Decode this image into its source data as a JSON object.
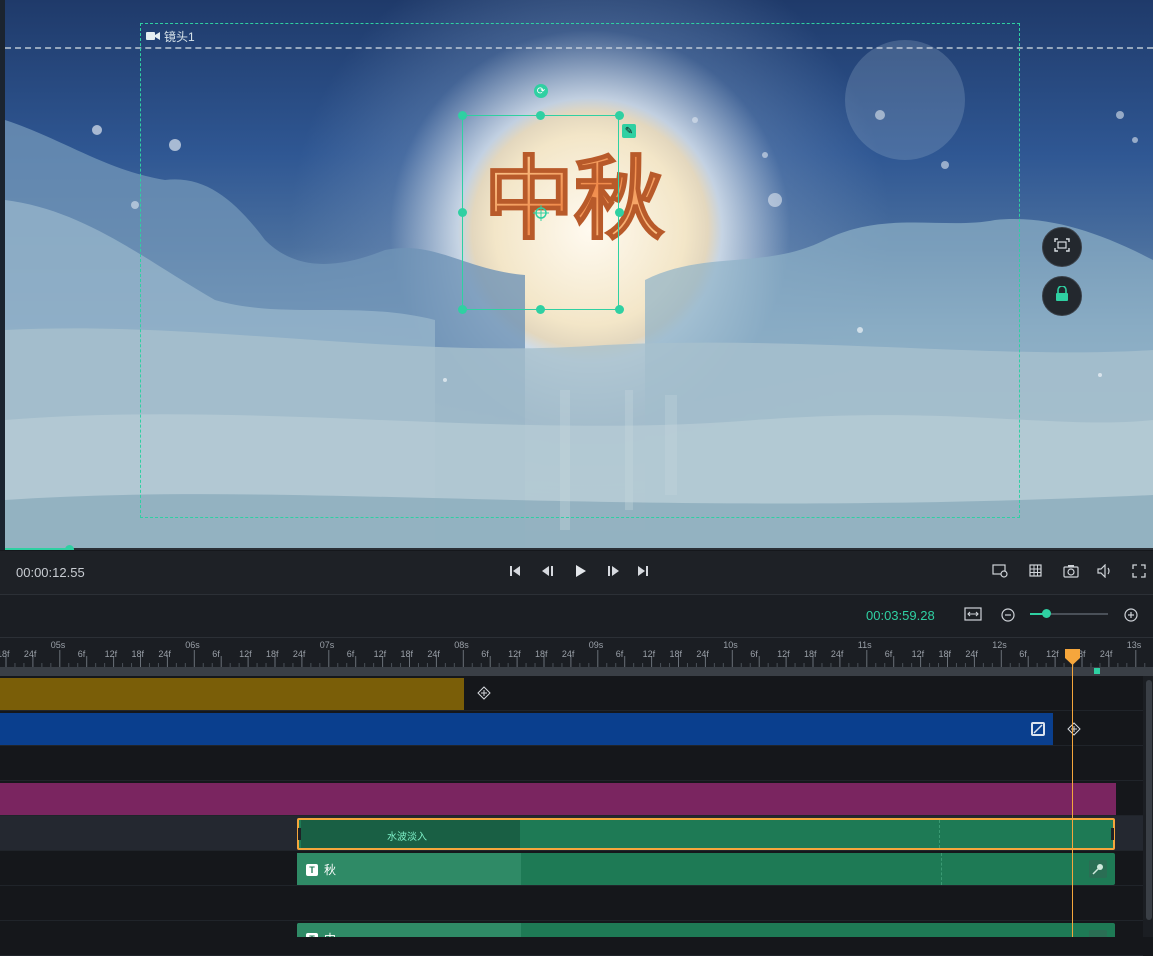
{
  "preview": {
    "camera_label": "镜头1",
    "title_text": "中秋",
    "icons": [
      "camera-icon",
      "rotate-icon",
      "pencil-icon",
      "fit-screen-icon",
      "lock-icon"
    ],
    "progress_fraction": 0.055
  },
  "transport": {
    "current_time": "00:00:12.55",
    "icons": [
      "skip-start-icon",
      "step-back-icon",
      "play-icon",
      "step-forward-icon",
      "skip-end-icon",
      "preview-settings-icon",
      "grid-icon",
      "screenshot-icon",
      "volume-icon",
      "fullscreen-icon"
    ]
  },
  "toolbar": {
    "total_time": "00:03:59.28",
    "zoom_level_fraction": 0.2,
    "icons": [
      "fit-timeline-icon",
      "zoom-out-icon",
      "zoom-in-icon"
    ]
  },
  "ruler": {
    "ticks": [
      {
        "t": "18f",
        "major": false
      },
      {
        "t": "24f",
        "major": false
      },
      {
        "t": "05s",
        "major": true
      },
      {
        "t": "6f",
        "major": false
      },
      {
        "t": "12f",
        "major": false
      },
      {
        "t": "18f",
        "major": false
      },
      {
        "t": "24f",
        "major": false
      },
      {
        "t": "06s",
        "major": true
      },
      {
        "t": "6f",
        "major": false
      },
      {
        "t": "12f",
        "major": false
      },
      {
        "t": "18f",
        "major": false
      },
      {
        "t": "24f",
        "major": false
      },
      {
        "t": "07s",
        "major": true
      },
      {
        "t": "6f",
        "major": false
      },
      {
        "t": "12f",
        "major": false
      },
      {
        "t": "18f",
        "major": false
      },
      {
        "t": "24f",
        "major": false
      },
      {
        "t": "08s",
        "major": true
      },
      {
        "t": "6f",
        "major": false
      },
      {
        "t": "12f",
        "major": false
      },
      {
        "t": "18f",
        "major": false
      },
      {
        "t": "24f",
        "major": false
      },
      {
        "t": "09s",
        "major": true
      },
      {
        "t": "6f",
        "major": false
      },
      {
        "t": "12f",
        "major": false
      },
      {
        "t": "18f",
        "major": false
      },
      {
        "t": "24f",
        "major": false
      },
      {
        "t": "10s",
        "major": true
      },
      {
        "t": "6f",
        "major": false
      },
      {
        "t": "12f",
        "major": false
      },
      {
        "t": "18f",
        "major": false
      },
      {
        "t": "24f",
        "major": false
      },
      {
        "t": "11s",
        "major": true
      },
      {
        "t": "6f",
        "major": false
      },
      {
        "t": "12f",
        "major": false
      },
      {
        "t": "18f",
        "major": false
      },
      {
        "t": "24f",
        "major": false
      },
      {
        "t": "12s",
        "major": true
      },
      {
        "t": "6f",
        "major": false
      },
      {
        "t": "12f",
        "major": false
      },
      {
        "t": "18f",
        "major": false
      },
      {
        "t": "24f",
        "major": false
      },
      {
        "t": "13s",
        "major": true
      }
    ]
  },
  "tracks": {
    "transition_clip_label": "水波淡入",
    "text_clip_1_label": "秋",
    "text_clip_2_label": "中",
    "text_badge": "T",
    "colors": {
      "gold": "#7a5e08",
      "blue": "#0a3f8e",
      "magenta": "#7a2560",
      "green": "#1e7a55",
      "green_light": "#2f8a66",
      "playhead": "#f5a63c",
      "accent": "#2fd0a2"
    }
  }
}
